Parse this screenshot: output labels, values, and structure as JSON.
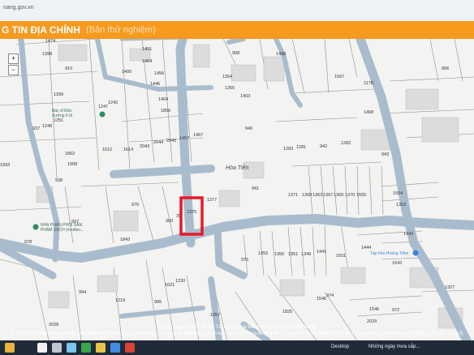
{
  "browser": {
    "url": "nang.gov.vn"
  },
  "header": {
    "title": "G TIN ĐỊA CHÍNH",
    "subtitle": "(Bản thử nghiệm)"
  },
  "map": {
    "zoom_in": "+",
    "zoom_out": "−",
    "area_label": "Hòa Tiến",
    "highlight_parcel": "1375",
    "parcels": [
      "1474",
      "1398",
      "910",
      "1451",
      "1464",
      "1400",
      "1456",
      "1404",
      "1446",
      "1856",
      "1467",
      "1399",
      "1247",
      "1242",
      "1248",
      "1251",
      "1612",
      "1614",
      "2043",
      "2044",
      "2045",
      "1457",
      "937",
      "1862",
      "1908",
      "1993",
      "938",
      "976",
      "1377",
      "1843",
      "997",
      "978",
      "360",
      "35",
      "1375",
      "908",
      "1498",
      "1354",
      "1355",
      "1403",
      "1567",
      "1178",
      "906",
      "940",
      "1468",
      "1283",
      "1281",
      "942",
      "1282",
      "943",
      "941",
      "1371",
      "1368",
      "1363",
      "1367",
      "1369",
      "1370",
      "1555",
      "1554",
      "1353",
      "975",
      "1352",
      "1350",
      "1351",
      "1349",
      "1441",
      "1501",
      "1443",
      "1444",
      "1543",
      "972",
      "1327",
      "994",
      "1219",
      "1621",
      "1220",
      "995",
      "1257",
      "974",
      "1825",
      "1545",
      "1546",
      "2029",
      "2028"
    ],
    "poi": [
      {
        "name": "Bác sĩ Đức",
        "sub": "Xưởng ô tô"
      },
      {
        "name": "NHÀ PHÂN PHỐI SẢN",
        "sub": "PHẨM SẠCH (mediso..."
      },
      {
        "name": "Tạp hóa Hoàng Trâm"
      }
    ]
  },
  "footer": {
    "line1": "© Bản quyền thuộc về Sở Tài nguyên và Môi trường thành phố Đà Nẵng",
    "line2": "ừ, đất dữ thử nghiệm dựa trên quy định hiện hành. Công dân muốn có thông tin khác hoặc trích lục hồ sơ vui lòng liên hệ đến Trung tâm Công nghệ thông tin Tài nguyên và Môi trường Đà Nẵng, địa chỉ: Tầng 6,"
  },
  "taskbar": {
    "desktop_label": "Desktop",
    "notification": "Những ngày mưa sắp..."
  },
  "colors": {
    "header": "#f79a1e",
    "road": "#a9bccd",
    "highlight": "#e8182a",
    "taskbar": "#202b3a"
  }
}
